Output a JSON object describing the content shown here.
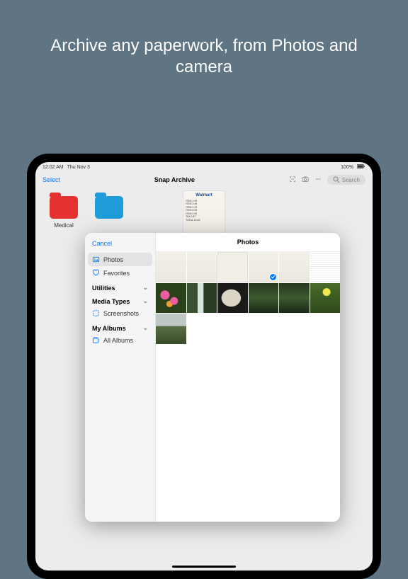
{
  "headline": "Archive any paperwork, from Photos and camera",
  "status": {
    "time": "12:02 AM",
    "date": "Thu Nov 3",
    "wifi": "􀙇",
    "battery": "100%"
  },
  "toolbar": {
    "select": "Select",
    "title": "Snap Archive",
    "search_placeholder": "Search"
  },
  "folders": [
    {
      "label": "Medical",
      "color": "red"
    },
    {
      "label": "",
      "color": "blue"
    }
  ],
  "receipt_brand": "Walmart",
  "picker": {
    "cancel": "Cancel",
    "header": "Photos",
    "sidebar": {
      "photos": "Photos",
      "favorites": "Favorites",
      "utilities": "Utilities",
      "screenshots": "Screenshots",
      "media_types": "Media Types",
      "my_albums": "My Albums",
      "all_albums": "All Albums"
    }
  }
}
